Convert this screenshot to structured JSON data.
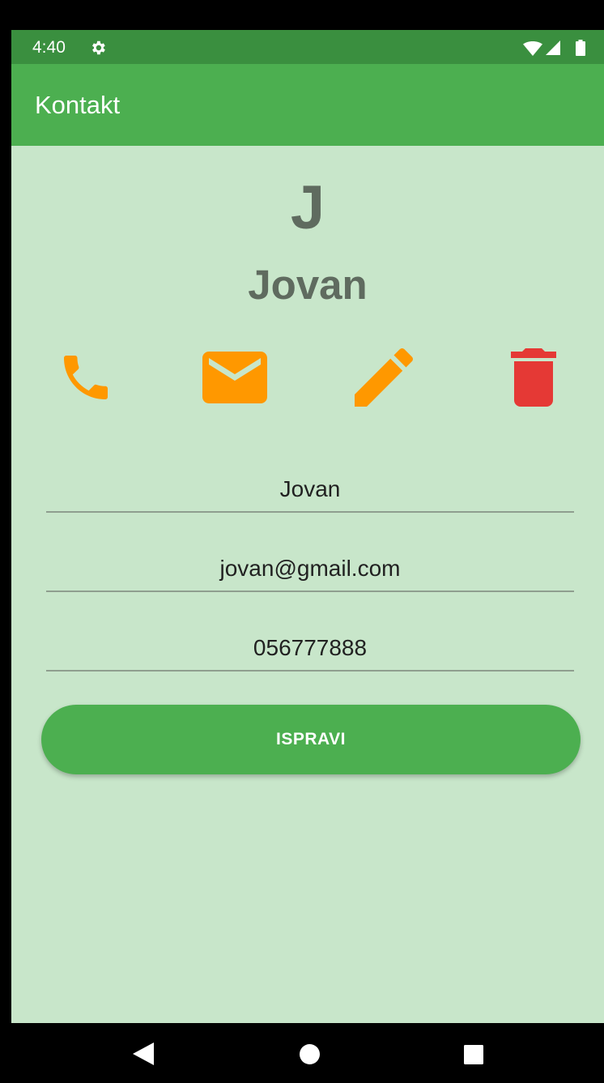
{
  "status_bar": {
    "time": "4:40",
    "icons": [
      "gear-icon",
      "wifi-icon",
      "signal-icon",
      "battery-icon"
    ]
  },
  "app_bar": {
    "title": "Kontakt",
    "color": "#4caf50"
  },
  "contact": {
    "initial": "J",
    "name": "Jovan"
  },
  "actions": [
    {
      "icon": "phone-icon",
      "color": "#ff9800"
    },
    {
      "icon": "mail-icon",
      "color": "#ff9800"
    },
    {
      "icon": "edit-icon",
      "color": "#ff9800"
    },
    {
      "icon": "delete-icon",
      "color": "#e53935"
    }
  ],
  "form": {
    "name_value": "Jovan",
    "email_value": "jovan@gmail.com",
    "phone_value": "056777888",
    "submit_label": "ISPRAVI"
  },
  "nav_bar": {
    "icons": [
      "back-icon",
      "home-icon",
      "recent-apps-icon"
    ]
  },
  "colors": {
    "background": "#c8e6ca",
    "primary": "#4caf50",
    "primary_dark": "#3a8f3f",
    "accent": "#ff9800",
    "danger": "#e53935"
  }
}
